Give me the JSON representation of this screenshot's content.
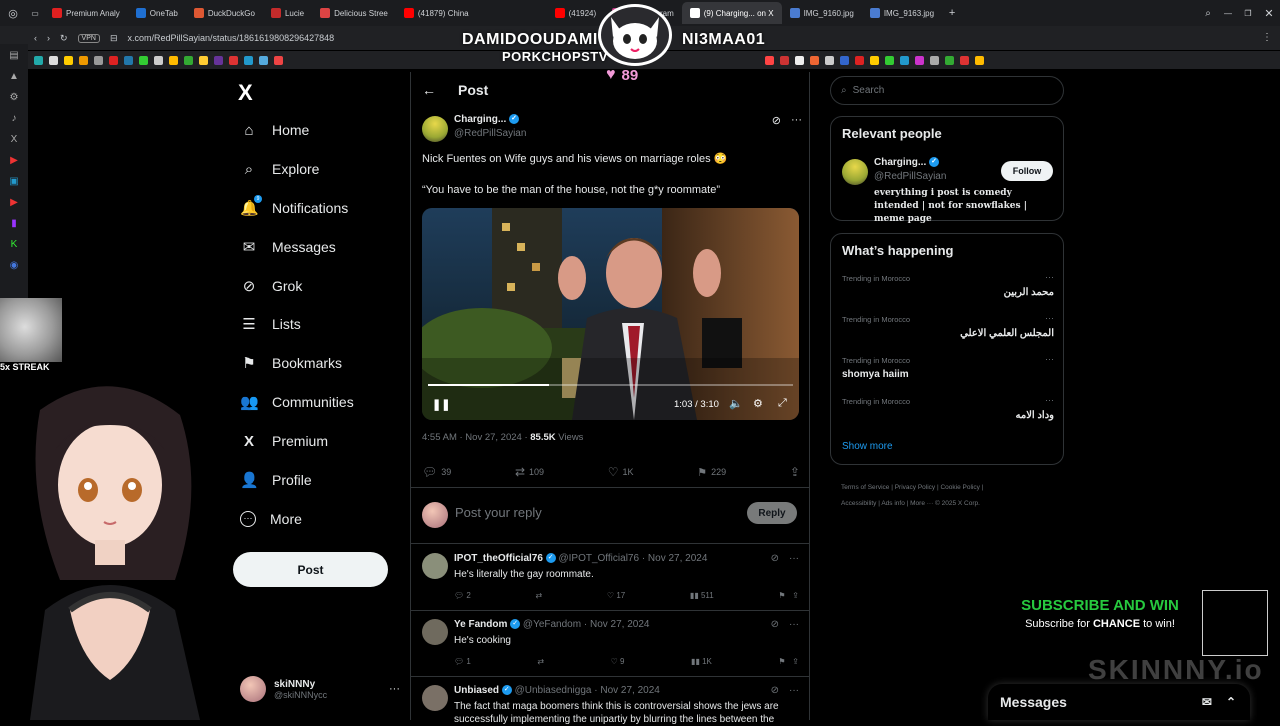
{
  "browser": {
    "tabs": [
      {
        "label": "Premium Analy",
        "color": "#e02020"
      },
      {
        "label": "OneTab",
        "color": "#1f6fd1"
      },
      {
        "label": "DuckDuckGo",
        "color": "#de5833"
      },
      {
        "label": "Lucie",
        "color": "#c42b2b"
      },
      {
        "label": "Delicious Stree",
        "color": "#d44"
      },
      {
        "label": "(41879) China",
        "color": "#ff0000"
      },
      {
        "label": "(41924)",
        "color": "#ff0000"
      },
      {
        "label": "(9) Instagram",
        "color": "#c13584"
      },
      {
        "label": "(9) Charging... on X",
        "color": "#ffffff"
      },
      {
        "label": "IMG_9160.jpg",
        "color": "#4a7bd0"
      },
      {
        "label": "IMG_9163.jpg",
        "color": "#4a7bd0"
      }
    ],
    "vpn_label": "VPN",
    "url": "x.com/RedPillSayian/status/1861619808296427848"
  },
  "nav": {
    "logo": "X",
    "items": [
      {
        "label": "Home",
        "icon": "⌂",
        "name": "home"
      },
      {
        "label": "Explore",
        "icon": "⌕",
        "name": "explore"
      },
      {
        "label": "Notifications",
        "icon": "🔔",
        "name": "notifications"
      },
      {
        "label": "Messages",
        "icon": "✉",
        "name": "messages"
      },
      {
        "label": "Grok",
        "icon": "⊘",
        "name": "grok"
      },
      {
        "label": "Lists",
        "icon": "☰",
        "name": "lists"
      },
      {
        "label": "Bookmarks",
        "icon": "⚑",
        "name": "bookmarks"
      },
      {
        "label": "Communities",
        "icon": "👥",
        "name": "communities"
      },
      {
        "label": "Premium",
        "icon": "X",
        "name": "premium"
      },
      {
        "label": "Profile",
        "icon": "👤",
        "name": "profile"
      },
      {
        "label": "More",
        "icon": "⋯",
        "name": "more"
      }
    ],
    "notif_badge": "9",
    "post_button": "Post",
    "account": {
      "name": "skiNNNy",
      "handle": "@skiNNNycc",
      "more": "···"
    }
  },
  "post": {
    "header_title": "Post",
    "back": "←",
    "author_name": "Charging...",
    "author_handle": "@RedPillSayian",
    "text_line1": "Nick Fuentes on Wife guys and his views on marriage roles 😳",
    "text_line2": "“You have to be the man of the house, not the g*y roommate”",
    "video_time": "1:03 / 3:10",
    "timestamp": "4:55 AM · Nov 27, 2024 · ",
    "views_count": "85.5K",
    "views_label": " Views",
    "actions": {
      "replies": "39",
      "reposts": "109",
      "likes": "1K",
      "bookmarks": "229"
    },
    "reply_placeholder": "Post your reply",
    "reply_button": "Reply"
  },
  "replies": [
    {
      "name": "IPOT_theOfficial76",
      "handle": "@IPOT_Official76",
      "date": "· Nov 27, 2024",
      "text": "He's literally the gay roommate.",
      "replies": "2",
      "reposts": "",
      "likes": "17",
      "views": "511",
      "avatar": "#8a8f7a"
    },
    {
      "name": "Ye Fandom",
      "handle": "@YeFandom",
      "date": "· Nov 27, 2024",
      "text": "He's cooking",
      "replies": "1",
      "reposts": "",
      "likes": "9",
      "views": "1K",
      "avatar": "#6f6a5e"
    },
    {
      "name": "Unbiased",
      "handle": "@Unbiasednigga",
      "date": "· Nov 27, 2024",
      "text": "The fact that maga boomers think this is controversial shows the jews are successfully implementing the unipartiy by blurring the lines between the",
      "replies": "",
      "reposts": "",
      "likes": "",
      "views": "",
      "avatar": "#7a7066"
    }
  ],
  "search": {
    "placeholder": "Search"
  },
  "relevant": {
    "title": "Relevant people",
    "name": "Charging...",
    "handle": "@RedPillSayian",
    "bio": "everything i post is comedy intended | not for snowflakes | meme page",
    "follow": "Follow"
  },
  "happening": {
    "title": "What’s happening",
    "trends": [
      {
        "meta": "Trending in Morocco",
        "name": "محمد الربين",
        "rtl": true
      },
      {
        "meta": "Trending in Morocco",
        "name": "المجلس العلمي الاعلي",
        "rtl": true
      },
      {
        "meta": "Trending in Morocco",
        "name": "shomya haiim",
        "rtl": false
      },
      {
        "meta": "Trending in Morocco",
        "name": "وداد الامه",
        "rtl": true
      }
    ],
    "show_more": "Show more"
  },
  "footer": {
    "line1": "Terms of Service  |  Privacy Policy  |  Cookie Policy  |",
    "line2": "Accessibility  |  Ads info  |  More ···  © 2025 X Corp."
  },
  "overlay": {
    "left_name": "DAMIDOOUDAMI",
    "sub_name": "PORKCHOPSTV",
    "right_name": "NI3MAA01",
    "heart_count": "89",
    "streak": "5x STREAK",
    "subscribe_title": "SUBSCRIBE AND WIN",
    "subscribe_text_pre": "Subscribe for ",
    "subscribe_text_bold": "CHANCE",
    "subscribe_text_post": " to win!",
    "brand": "SKINNNY.io",
    "subscribe_color": "#27c93f"
  },
  "messages_drawer": {
    "title": "Messages"
  }
}
